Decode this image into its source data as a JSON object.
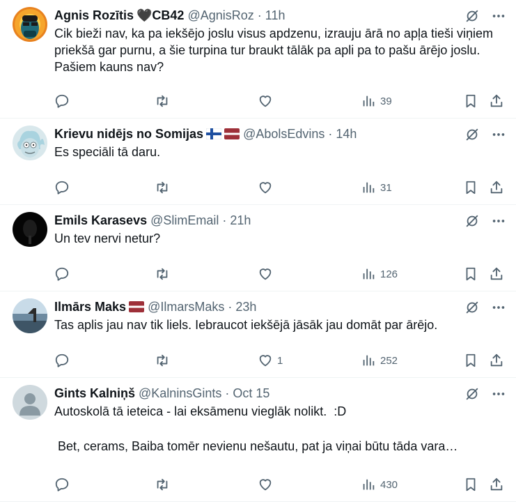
{
  "tweets": [
    {
      "name": "Agnis Rozītis",
      "name_suffix": "🖤CB42",
      "handle": "@AgnisRoz",
      "time": "11h",
      "paragraphs": [
        "Cik bieži nav, ka pa iekšējo joslu visus apdzenu, izrauju ārā no apļa tieši viņiem priekšā gar purnu, a šie turpina tur braukt tālāk pa apli pa to pašu ārējo joslu. Pašiem kauns nav?"
      ],
      "replies": "",
      "retweets": "",
      "likes": "",
      "views": "39",
      "flags": []
    },
    {
      "name": "Krievu nidējs no Somijas",
      "name_suffix": "",
      "handle": "@AbolsEdvins",
      "time": "14h",
      "paragraphs": [
        "Es speciāli tā daru."
      ],
      "replies": "",
      "retweets": "",
      "likes": "",
      "views": "31",
      "flags": [
        "finland",
        "latvia"
      ]
    },
    {
      "name": "Emils Karasevs",
      "name_suffix": "",
      "handle": "@SlimEmail",
      "time": "21h",
      "paragraphs": [
        "Un tev nervi netur?"
      ],
      "replies": "",
      "retweets": "",
      "likes": "",
      "views": "126",
      "flags": []
    },
    {
      "name": "Ilmārs Maks",
      "name_suffix": "",
      "handle": "@IlmarsMaks",
      "time": "23h",
      "paragraphs": [
        "Tas aplis jau nav tik liels. Iebraucot iekšējā jāsāk jau domāt par ārējo."
      ],
      "replies": "",
      "retweets": "",
      "likes": "1",
      "views": "252",
      "flags": [
        "latvia"
      ]
    },
    {
      "name": "Gints Kalniņš",
      "name_suffix": "",
      "handle": "@KalninsGints",
      "time": "Oct 15",
      "paragraphs": [
        "Autoskolā tā ieteica - lai eksāmenu vieglāk nolikt.  :D",
        " Bet, cerams, Baiba tomēr nevienu nešautu, pat ja viņai būtu tāda vara…"
      ],
      "replies": "",
      "retweets": "",
      "likes": "",
      "views": "430",
      "flags": []
    }
  ],
  "icons": {
    "reply": "reply-icon",
    "retweet": "retweet-icon",
    "like": "heart-icon",
    "views": "views-chart-icon",
    "bookmark": "bookmark-icon",
    "share": "share-icon",
    "grok": "grok-icon",
    "more": "more-icon"
  },
  "colors": {
    "text": "#0f1419",
    "secondary": "#536471",
    "divider": "#eff3f4"
  }
}
